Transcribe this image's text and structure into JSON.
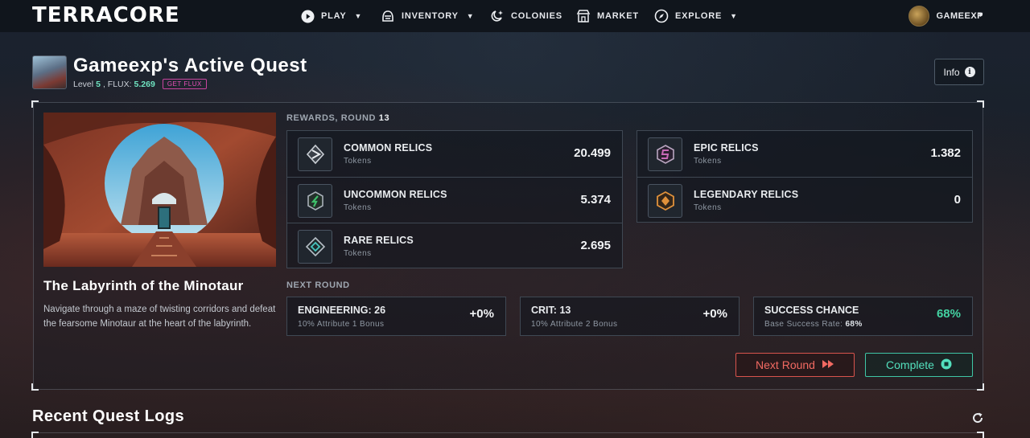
{
  "nav": {
    "logo": "TERRACORE",
    "items": [
      {
        "label": "PLAY",
        "icon": "play-circle-icon",
        "dropdown": true
      },
      {
        "label": "INVENTORY",
        "icon": "helmet-icon",
        "dropdown": true
      },
      {
        "label": "COLONIES",
        "icon": "colonies-icon",
        "dropdown": false
      },
      {
        "label": "MARKET",
        "icon": "store-icon",
        "dropdown": false
      },
      {
        "label": "EXPLORE",
        "icon": "compass-icon",
        "dropdown": true
      }
    ],
    "user": {
      "name": "GAMEEXP",
      "icon": "user-avatar"
    }
  },
  "header": {
    "title": "Gameexp's Active Quest",
    "level_label": "Level",
    "level": "5",
    "flux_label": ", FLUX:",
    "flux": "5.269",
    "get_flux": "GET FLUX",
    "info_label": "Info"
  },
  "quest": {
    "name": "The Labyrinth of the Minotaur",
    "description": "Navigate through a maze of twisting corridors and defeat the fearsome Minotaur at the heart of the labyrinth."
  },
  "rewards": {
    "label": "REWARDS, ROUND",
    "round": "13",
    "left": [
      {
        "name": "COMMON RELICS",
        "sub": "Tokens",
        "value": "20.499",
        "icon": "common-relic-icon",
        "color": "#b9c0c8"
      },
      {
        "name": "UNCOMMON RELICS",
        "sub": "Tokens",
        "value": "5.374",
        "icon": "uncommon-relic-icon",
        "color": "#3fbf6a"
      },
      {
        "name": "RARE RELICS",
        "sub": "Tokens",
        "value": "2.695",
        "icon": "rare-relic-icon",
        "color": "#48c6c1"
      }
    ],
    "right": [
      {
        "name": "EPIC RELICS",
        "sub": "Tokens",
        "value": "1.382",
        "icon": "epic-relic-icon",
        "color": "#c86ab7"
      },
      {
        "name": "LEGENDARY RELICS",
        "sub": "Tokens",
        "value": "0",
        "icon": "legendary-relic-icon",
        "color": "#e0913b"
      }
    ]
  },
  "next_round": {
    "label": "NEXT ROUND",
    "stats": [
      {
        "name": "ENGINEERING:",
        "num": "26",
        "sub": "10% Attribute 1 Bonus",
        "value": "+0%"
      },
      {
        "name": "CRIT:",
        "num": "13",
        "sub": "10% Attribute 2 Bonus",
        "value": "+0%"
      },
      {
        "name": "SUCCESS CHANCE",
        "num": "",
        "sub": "Base Success Rate:",
        "sub_value": "68%",
        "value": "68%"
      }
    ],
    "next_button": "Next Round",
    "complete_button": "Complete"
  },
  "logs": {
    "title": "Recent Quest Logs"
  },
  "colors": {
    "accent_green": "#43d3a2",
    "accent_red": "#f26a62",
    "accent_pink": "#e34fb5"
  }
}
